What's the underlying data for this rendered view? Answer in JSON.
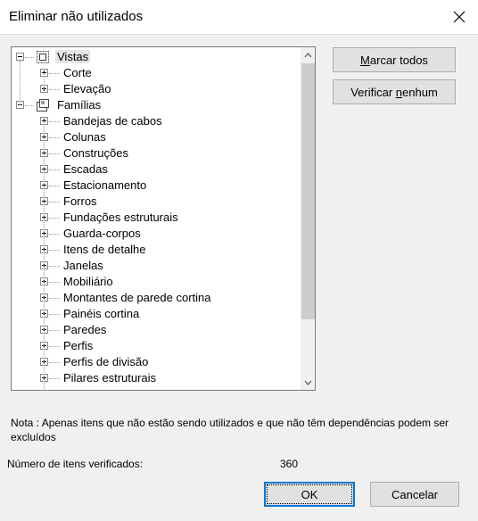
{
  "window": {
    "title": "Eliminar não utilizados"
  },
  "tree": {
    "items": [
      {
        "label": "Vistas",
        "level": 0,
        "icon": "views-icon",
        "selected": true
      },
      {
        "label": "Corte",
        "level": 1
      },
      {
        "label": "Elevação",
        "level": 1
      },
      {
        "label": "Famílias",
        "level": 0,
        "icon": "families-icon"
      },
      {
        "label": "Bandejas de cabos",
        "level": 1
      },
      {
        "label": "Colunas",
        "level": 1
      },
      {
        "label": "Construções",
        "level": 1
      },
      {
        "label": "Escadas",
        "level": 1
      },
      {
        "label": "Estacionamento",
        "level": 1
      },
      {
        "label": "Forros",
        "level": 1
      },
      {
        "label": "Fundações estruturais",
        "level": 1
      },
      {
        "label": "Guarda-corpos",
        "level": 1
      },
      {
        "label": "Itens de detalhe",
        "level": 1
      },
      {
        "label": "Janelas",
        "level": 1
      },
      {
        "label": "Mobiliário",
        "level": 1
      },
      {
        "label": "Montantes de parede cortina",
        "level": 1
      },
      {
        "label": "Painéis cortina",
        "level": 1
      },
      {
        "label": "Paredes",
        "level": 1
      },
      {
        "label": "Perfis",
        "level": 1
      },
      {
        "label": "Perfis de divisão",
        "level": 1
      },
      {
        "label": "Pilares estruturais",
        "level": 1
      }
    ]
  },
  "buttons": {
    "mark_all_prefix": "",
    "mark_all_mnemonic": "M",
    "mark_all_suffix": "arcar todos",
    "check_none_prefix": "Verificar ",
    "check_none_mnemonic": "n",
    "check_none_suffix": "enhum",
    "ok": "OK",
    "cancel": "Cancelar"
  },
  "note": "Nota : Apenas itens que não estão sendo utilizados e que não têm dependências podem ser excluídos",
  "count": {
    "label": "Número de itens verificados:",
    "value": "360"
  },
  "colors": {
    "accent": "#0078d7",
    "selection": "#e5e5e5"
  }
}
